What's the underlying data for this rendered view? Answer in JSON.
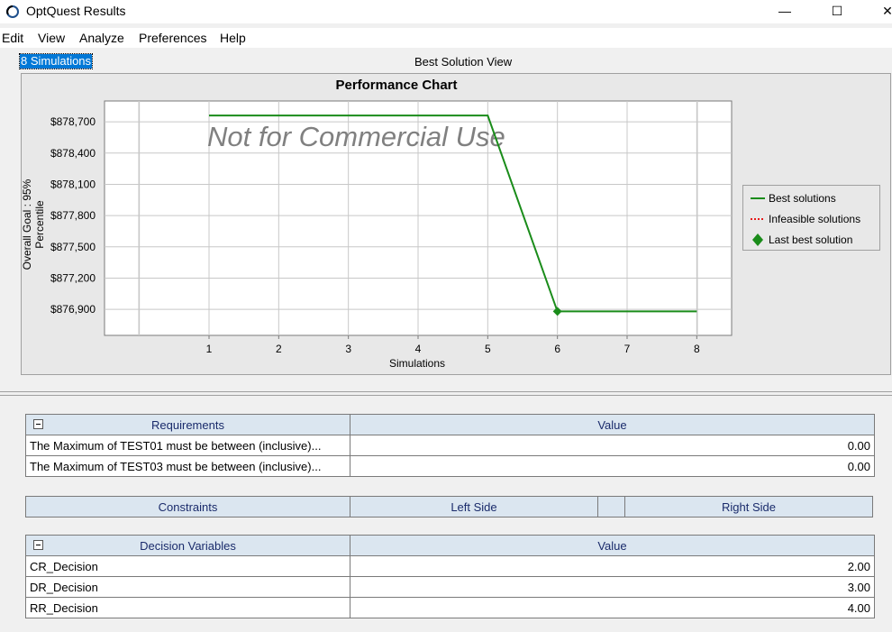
{
  "window": {
    "title": "OptQuest Results",
    "minimize": "—",
    "maximize": "☐",
    "close": "✕"
  },
  "menu": [
    "Edit",
    "View",
    "Analyze",
    "Preferences",
    "Help"
  ],
  "tabs": {
    "simulations": "8 Simulations",
    "view_title": "Best Solution View"
  },
  "watermark": "Not for Commercial Use",
  "colors": {
    "series": "#1a8c1a",
    "infeasible": "#e81a1a",
    "header_bg": "#dbe6f0",
    "header_text": "#1a2b6b",
    "selection": "#0078d7"
  },
  "chart_data": {
    "type": "line",
    "title": "Performance Chart",
    "xlabel": "Simulations",
    "ylabel": "Overall Goal : 95% Percentile",
    "x_ticks": [
      "1",
      "2",
      "3",
      "4",
      "5",
      "6",
      "7",
      "8"
    ],
    "y_ticks": [
      "$878,700",
      "$878,400",
      "$878,100",
      "$877,800",
      "$877,500",
      "$877,200",
      "$876,900"
    ],
    "xlim": [
      -0.5,
      8.5
    ],
    "ylim": [
      876650,
      878900
    ],
    "series": [
      {
        "name": "Best solutions",
        "x": [
          1,
          5,
          6,
          8
        ],
        "y": [
          878760,
          878760,
          876880,
          876880
        ]
      }
    ],
    "last_best": {
      "x": 6,
      "y": 876880
    },
    "legend": [
      {
        "label": "Best solutions",
        "style": "line"
      },
      {
        "label": "Infeasible solutions",
        "style": "dotted"
      },
      {
        "label": "Last best solution",
        "style": "diamond"
      }
    ],
    "legend_position": "right",
    "grid": true
  },
  "requirements": {
    "headers": [
      "Requirements",
      "Value"
    ],
    "rows": [
      {
        "name": "The Maximum of TEST01 must be between (inclusive)...",
        "value": "0.00"
      },
      {
        "name": "The Maximum of TEST03 must be between (inclusive)...",
        "value": "0.00"
      }
    ]
  },
  "constraints": {
    "headers": [
      "Constraints",
      "Left Side",
      "",
      "Right Side"
    ]
  },
  "decision_variables": {
    "headers": [
      "Decision Variables",
      "Value"
    ],
    "rows": [
      {
        "name": "CR_Decision",
        "value": "2.00"
      },
      {
        "name": "DR_Decision",
        "value": "3.00"
      },
      {
        "name": "RR_Decision",
        "value": "4.00"
      }
    ]
  }
}
